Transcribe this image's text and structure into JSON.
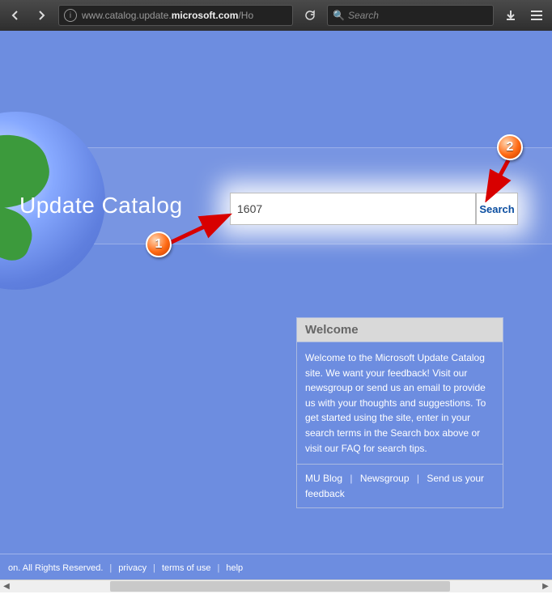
{
  "browser": {
    "url_pre": "www.catalog.update.",
    "url_strong": "microsoft.com",
    "url_post": "/Ho",
    "search_placeholder": "Search"
  },
  "page": {
    "title": "Update Catalog",
    "search_value": "1607",
    "search_button": "Search"
  },
  "welcome": {
    "title": "Welcome",
    "body": "Welcome to the Microsoft Update Catalog site. We want your feedback! Visit our newsgroup or send us an email to provide us with your thoughts and suggestions. To get started using the site, enter in your search terms in the Search box above or visit our FAQ for search tips.",
    "links": {
      "blog": "MU Blog",
      "newsgroup": "Newsgroup",
      "feedback": "Send us your feedback"
    }
  },
  "footer": {
    "rights": "on. All Rights Reserved.",
    "privacy": "privacy",
    "terms": "terms of use",
    "help": "help"
  },
  "annotation": {
    "badge1": "1",
    "badge2": "2"
  }
}
